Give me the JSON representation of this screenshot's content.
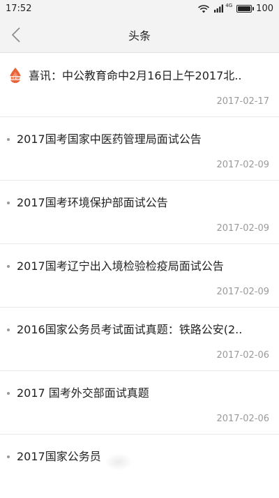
{
  "status_bar": {
    "time": "17:52",
    "network_label": "4G",
    "battery_text": "100",
    "battery_level": 1.0
  },
  "header": {
    "title": "头条",
    "back_icon": "chevron-left-icon"
  },
  "news": [
    {
      "title": "喜讯：中公教育命中2月16日上午2017北..",
      "date": "2017-02-17",
      "featured": true,
      "badge_icon": "new-badge-icon"
    },
    {
      "title": "2017国考国家中医药管理局面试公告",
      "date": "2017-02-09"
    },
    {
      "title": "2017国考环境保护部面试公告",
      "date": "2017-02-09"
    },
    {
      "title": "2017国考辽宁出入境检验检疫局面试公告",
      "date": "2017-02-09"
    },
    {
      "title": "2016国家公务员考试面试真题：铁路公安(2..",
      "date": "2017-02-06"
    },
    {
      "title": "2017 国考外交部面试真题",
      "date": "2017-02-06"
    },
    {
      "title": "2017国家公务员",
      "date": ""
    }
  ],
  "colors": {
    "header_bg": "#f3f3f3",
    "divider": "#e8e8e8",
    "date_text": "#9a9a9a",
    "badge": "#e8623a"
  }
}
